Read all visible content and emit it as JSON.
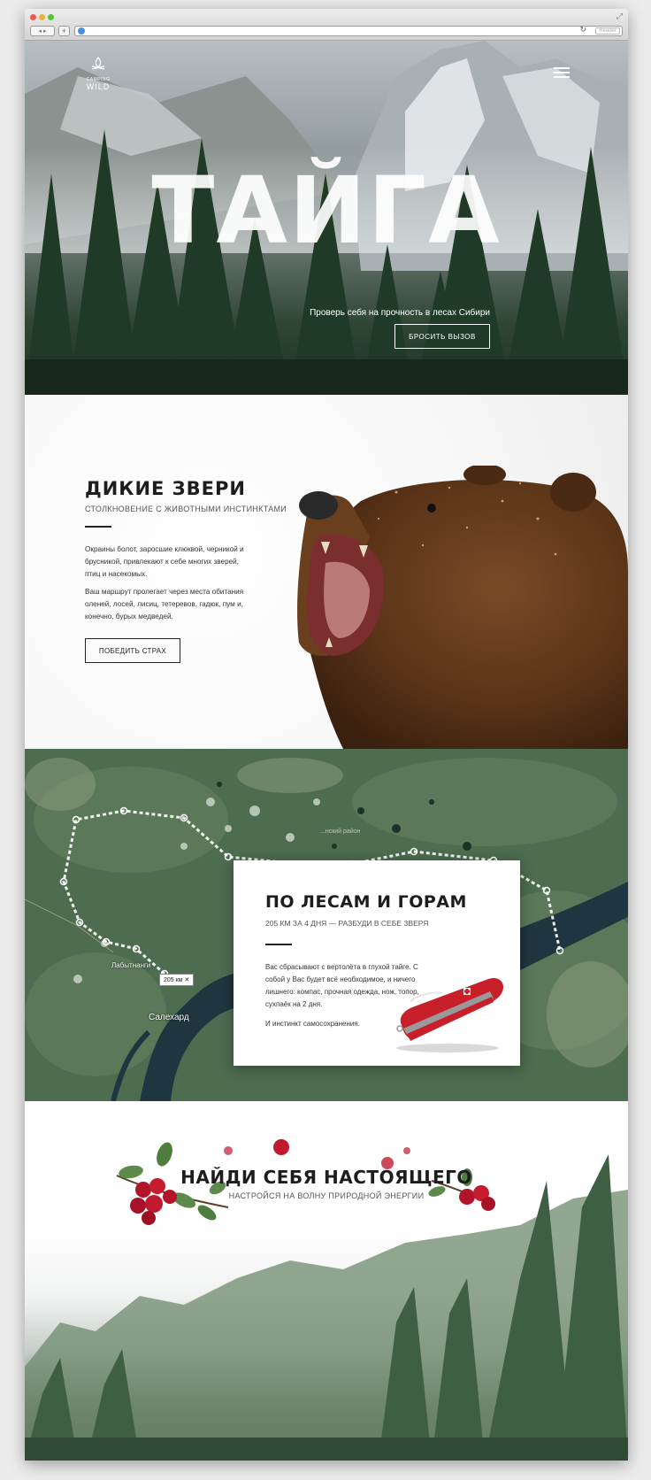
{
  "browser": {
    "nav_arrows": "◂ ▸",
    "new_tab": "+",
    "reload": "↻",
    "reader": "Reader"
  },
  "hero": {
    "logo_line1": "CAMPING",
    "logo_line2": "WILD",
    "title": "ТАЙГА",
    "subtitle": "Проверь себя на прочность в лесах Сибири",
    "cta": "БРОСИТЬ ВЫЗОВ"
  },
  "wild": {
    "title": "ДИКИЕ ЗВЕРИ",
    "subtitle": "СТОЛКНОВЕНИЕ С ЖИВОТНЫМИ ИНСТИНКТАМИ",
    "p1": "Окраины болот, заросшие клюквой, черникой и брусникой, привлекают к себе многих зверей, птиц и насекомых.",
    "p2": "Ваш маршрут пролегает через места обитания оленей, лосей, лисиц, тетеревов, гадюк, пум и, конечно, бурых медведей.",
    "cta": "ПОБЕДИТЬ СТРАХ"
  },
  "route": {
    "title": "ПО ЛЕСАМ И ГОРАМ",
    "subtitle": "205 КМ ЗА 4 ДНЯ — РАЗБУДИ В СЕБЕ ЗВЕРЯ",
    "p1": "Вас сбрасывают с вертолёта в глухой тайге. С собой у Вас будет всё необходимое, и ничего лишнего: компас, прочная одежда, нож, топор, сухпаёк на 2 дня.",
    "p2": "И инстинкт самосохранения.",
    "distance": "205 км ✕",
    "city1": "Лабытнанги",
    "city2": "Салехард",
    "region": "...нский район"
  },
  "find": {
    "title": "НАЙДИ СЕБЯ НАСТОЯЩЕГО",
    "subtitle": "НАСТРОЙСЯ НА ВОЛНУ ПРИРОДНОЙ ЭНЕРГИИ"
  }
}
